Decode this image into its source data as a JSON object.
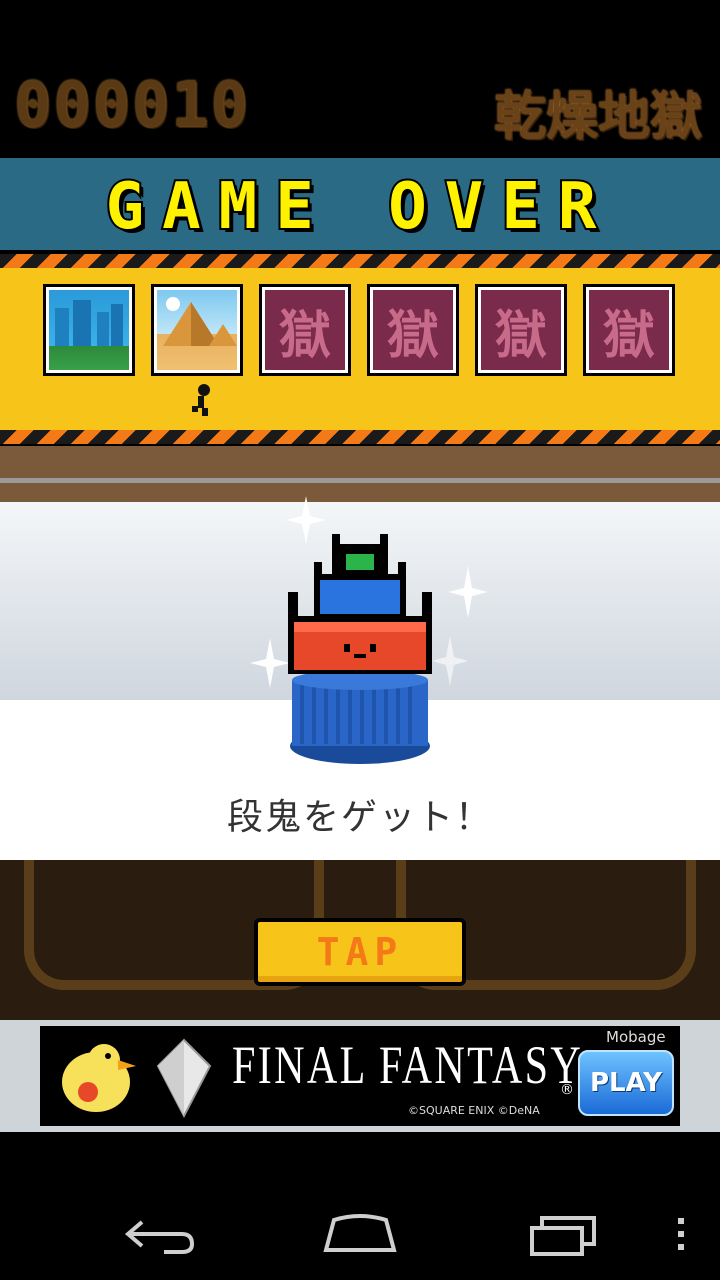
{
  "header": {
    "score": "000010",
    "stage_name": "乾燥地獄"
  },
  "banner": {
    "title": "GAME OVER"
  },
  "stages": [
    {
      "name": "stage-1",
      "locked": false
    },
    {
      "name": "stage-2",
      "locked": false
    },
    {
      "name": "stage-3",
      "locked": true,
      "glyph": "獄"
    },
    {
      "name": "stage-4",
      "locked": true,
      "glyph": "獄"
    },
    {
      "name": "stage-5",
      "locked": true,
      "glyph": "獄"
    },
    {
      "name": "stage-6",
      "locked": true,
      "glyph": "獄"
    }
  ],
  "result": {
    "message": "段鬼をゲット！"
  },
  "button": {
    "tap_label": "TAP"
  },
  "ad": {
    "title": "FINAL FANTASY",
    "registered_mark": "®",
    "brand": "Mobage",
    "play_label": "PLAY",
    "copyright": "©SQUARE ENIX ©DeNA"
  },
  "icons": [
    "back-icon",
    "home-icon",
    "recent-apps-icon",
    "overflow-menu-icon",
    "player-marker-icon",
    "sparkle-icon"
  ],
  "colors": {
    "banner_yellow": "#fff200",
    "panel_yellow": "#f7c51a",
    "hazard_orange": "#f47a18",
    "band_blue": "#2b6a84"
  }
}
